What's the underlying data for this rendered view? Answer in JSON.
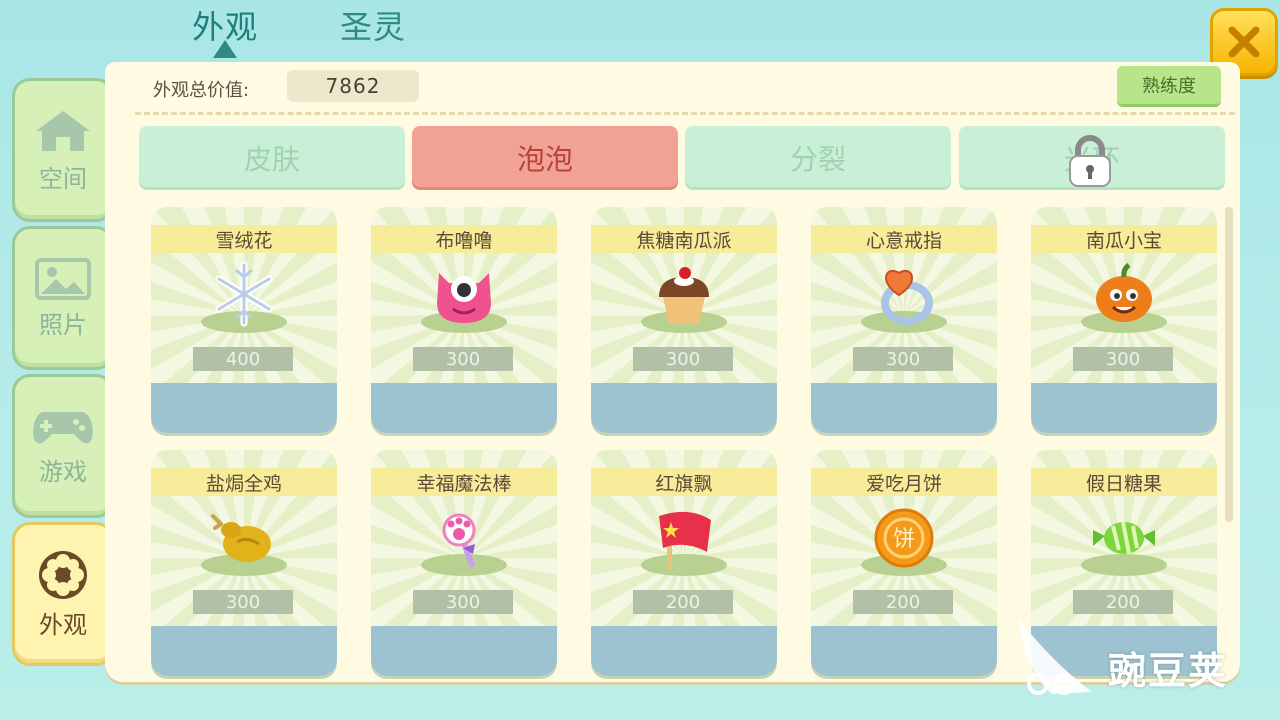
{
  "top_tabs": [
    {
      "label": "外观",
      "active": true
    },
    {
      "label": "圣灵",
      "active": false
    }
  ],
  "side_nav": [
    {
      "label": "空间",
      "icon": "house-icon",
      "active": false
    },
    {
      "label": "照片",
      "icon": "picture-icon",
      "active": false
    },
    {
      "label": "游戏",
      "icon": "gamepad-icon",
      "active": false
    },
    {
      "label": "外观",
      "icon": "flower-icon",
      "active": true
    }
  ],
  "header": {
    "value_label": "外观总价值:",
    "value": "7862",
    "mastery_button": "熟练度"
  },
  "categories": [
    {
      "label": "皮肤",
      "active": false
    },
    {
      "label": "泡泡",
      "active": true
    },
    {
      "label": "分裂",
      "active": false
    },
    {
      "label": "光环",
      "active": false,
      "locked": true
    }
  ],
  "items": [
    {
      "name": "雪绒花",
      "price": "400",
      "icon": "snowflake-icon"
    },
    {
      "name": "布噜噜",
      "price": "300",
      "icon": "pink-monster-icon"
    },
    {
      "name": "焦糖南瓜派",
      "price": "300",
      "icon": "cupcake-icon"
    },
    {
      "name": "心意戒指",
      "price": "300",
      "icon": "heart-ring-icon"
    },
    {
      "name": "南瓜小宝",
      "price": "300",
      "icon": "pumpkin-icon"
    },
    {
      "name": "盐焗全鸡",
      "price": "300",
      "icon": "roast-chicken-icon"
    },
    {
      "name": "幸福魔法棒",
      "price": "300",
      "icon": "paw-wand-icon"
    },
    {
      "name": "红旗飘",
      "price": "200",
      "icon": "red-flag-icon"
    },
    {
      "name": "爱吃月饼",
      "price": "200",
      "icon": "mooncake-icon"
    },
    {
      "name": "假日糖果",
      "price": "200",
      "icon": "candy-icon"
    }
  ],
  "watermark": {
    "text": "豌豆荚"
  },
  "colors": {
    "accent_active": "#f2a294",
    "panel": "#fffae2",
    "close_button": "#f7b400"
  }
}
